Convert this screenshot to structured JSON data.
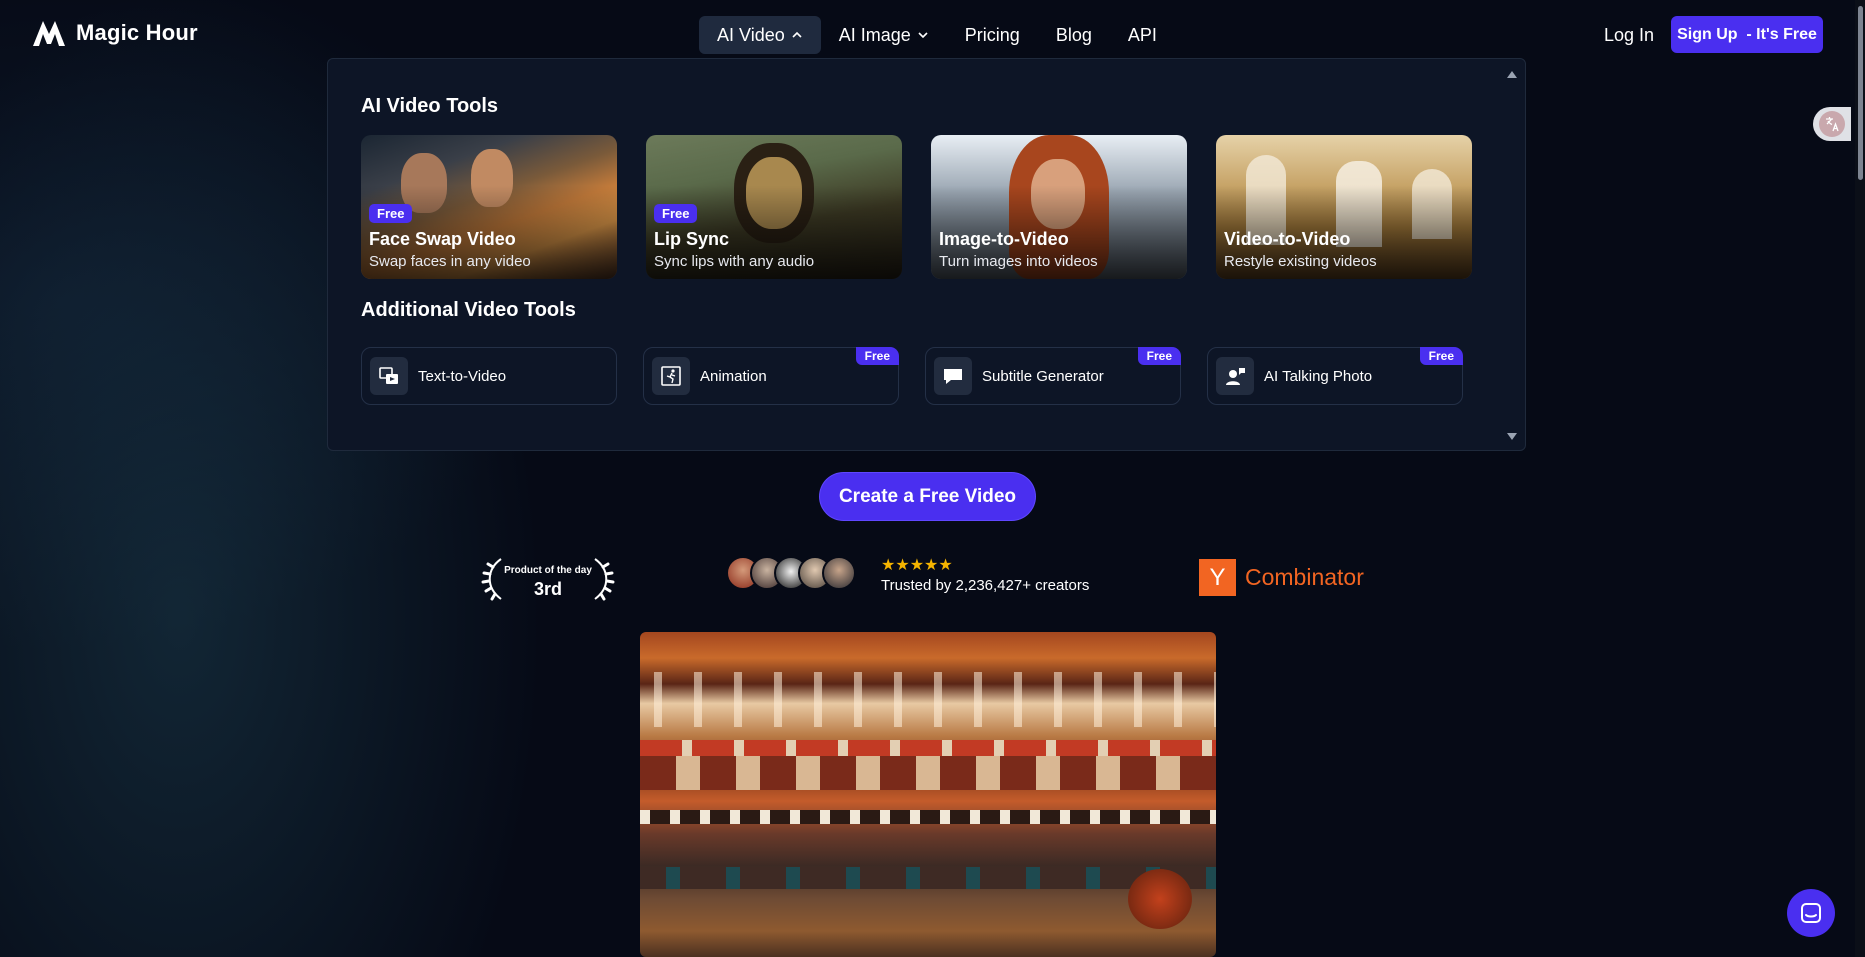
{
  "brand": {
    "name": "Magic Hour"
  },
  "nav": {
    "links": [
      {
        "label": "AI Video",
        "icon": "chevron-up-icon"
      },
      {
        "label": "AI Image",
        "icon": "chevron-down-icon"
      },
      {
        "label": "Pricing"
      },
      {
        "label": "Blog"
      },
      {
        "label": "API"
      }
    ],
    "login": "Log In",
    "signup": "Sign Up  - It's Free"
  },
  "dropdown": {
    "title": "AI Video Tools",
    "cards": [
      {
        "title": "Face Swap Video",
        "subtitle": "Swap faces in any video",
        "badge": "Free"
      },
      {
        "title": "Lip Sync",
        "subtitle": "Sync lips with any audio",
        "badge": "Free"
      },
      {
        "title": "Image-to-Video",
        "subtitle": "Turn images into videos"
      },
      {
        "title": "Video-to-Video",
        "subtitle": "Restyle existing videos"
      }
    ],
    "additional_title": "Additional Video Tools",
    "tools": [
      {
        "label": "Text-to-Video",
        "icon": "text-to-video-icon"
      },
      {
        "label": "Animation",
        "icon": "animation-icon",
        "badge": "Free"
      },
      {
        "label": "Subtitle Generator",
        "icon": "speech-bubble-icon",
        "badge": "Free"
      },
      {
        "label": "AI Talking Photo",
        "icon": "talking-person-icon",
        "badge": "Free"
      }
    ]
  },
  "cta": "Create a Free Video",
  "social": {
    "potd_small": "Product of the day",
    "potd_rank": "3rd",
    "stars": "★★★★★",
    "trusted": "Trusted by 2,236,427+ creators",
    "yc_letter": "Y",
    "yc_text": "Combinator"
  },
  "colors": {
    "accent": "#4a2ff0",
    "background": "#060a16",
    "panel": "#0d1526",
    "yc": "#f26522"
  }
}
